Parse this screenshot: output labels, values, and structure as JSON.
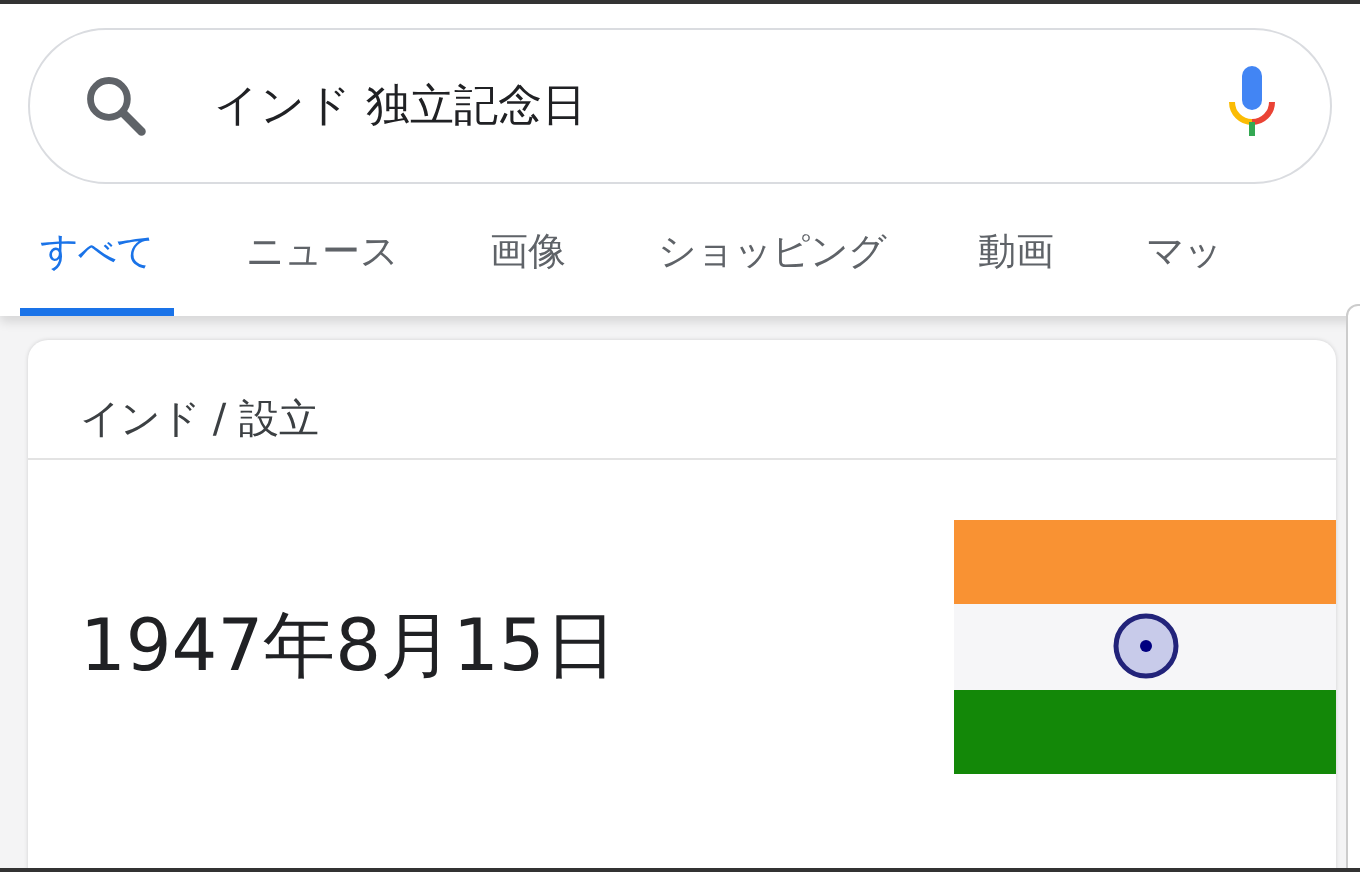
{
  "search": {
    "value": "インド 独立記念日"
  },
  "tabs": [
    {
      "label": "すべて",
      "selected": true
    },
    {
      "label": "ニュース",
      "selected": false
    },
    {
      "label": "画像",
      "selected": false
    },
    {
      "label": "ショッピング",
      "selected": false
    },
    {
      "label": "動画",
      "selected": false
    },
    {
      "label": "マッ",
      "selected": false
    }
  ],
  "card": {
    "breadcrumb": "インド / 設立",
    "answer": "1947年8月15日"
  }
}
